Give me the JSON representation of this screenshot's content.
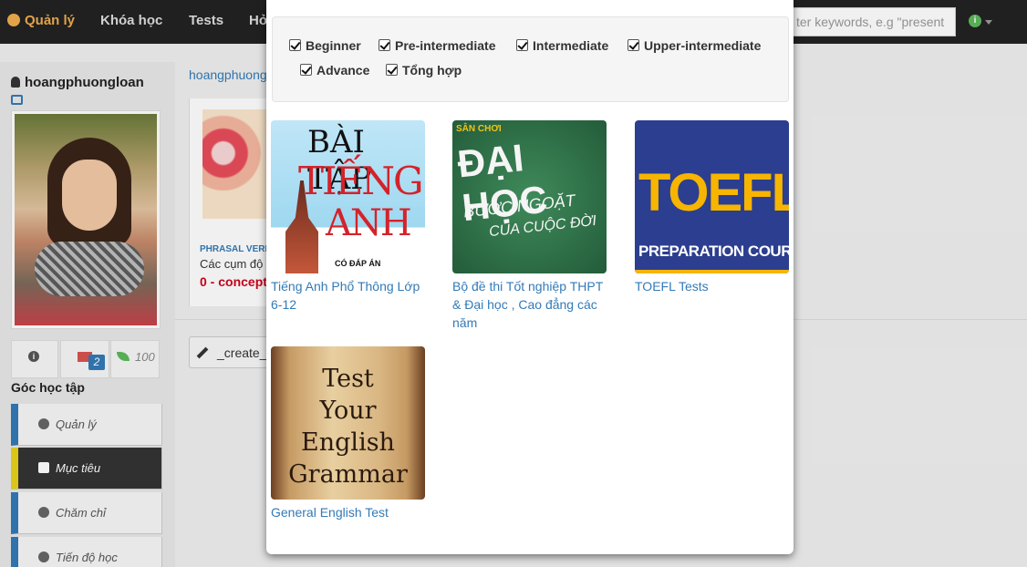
{
  "navbar": {
    "brand": "Quản lý",
    "items": [
      "Khóa học",
      "Tests",
      "Hỏ"
    ],
    "search_placeholder": "ter keywords, e.g \"present"
  },
  "sidebar": {
    "username": "hoangphuongloan",
    "message_count": "2",
    "points": "100",
    "section_title": "Góc học tập",
    "items": [
      {
        "label": "Quản lý"
      },
      {
        "label": "Mục tiêu"
      },
      {
        "label": "Chăm chỉ"
      },
      {
        "label": "Tiến độ học"
      }
    ]
  },
  "main": {
    "breadcrumb": "hoangphuong",
    "card": {
      "label": "PHRASAL VERB",
      "title": "Các cụm độ",
      "score": "0 - concept"
    },
    "create_button": "_create_"
  },
  "modal": {
    "filters": [
      {
        "label": "Beginner",
        "checked": true
      },
      {
        "label": "Pre-intermediate",
        "checked": true
      },
      {
        "label": "Intermediate",
        "checked": true
      },
      {
        "label": "Upper-intermediate",
        "checked": true
      },
      {
        "label": "Advance",
        "checked": true
      },
      {
        "label": "Tổng hợp",
        "checked": true
      }
    ],
    "courses": [
      {
        "title": "Tiếng Anh Phổ Thông Lớp 6-12",
        "cover": [
          "BÀI TẬP",
          "TIẾNG",
          "ANH",
          "CÓ ĐÁP ÁN"
        ]
      },
      {
        "title": "Bộ đề thi Tốt nghiệp THPT & Đại học , Cao đẳng các năm",
        "cover": [
          "SÂN CHƠI",
          "ĐẠI HỌC",
          "BƯỚC NGOẶT",
          "CỦA CUỘC ĐỜI"
        ]
      },
      {
        "title": "TOEFL Tests",
        "cover": [
          "TOEFL",
          "PREPARATION COURSE"
        ]
      },
      {
        "title": "General English Test",
        "cover": [
          "Test",
          "Your",
          "English",
          "Grammar"
        ]
      }
    ]
  }
}
